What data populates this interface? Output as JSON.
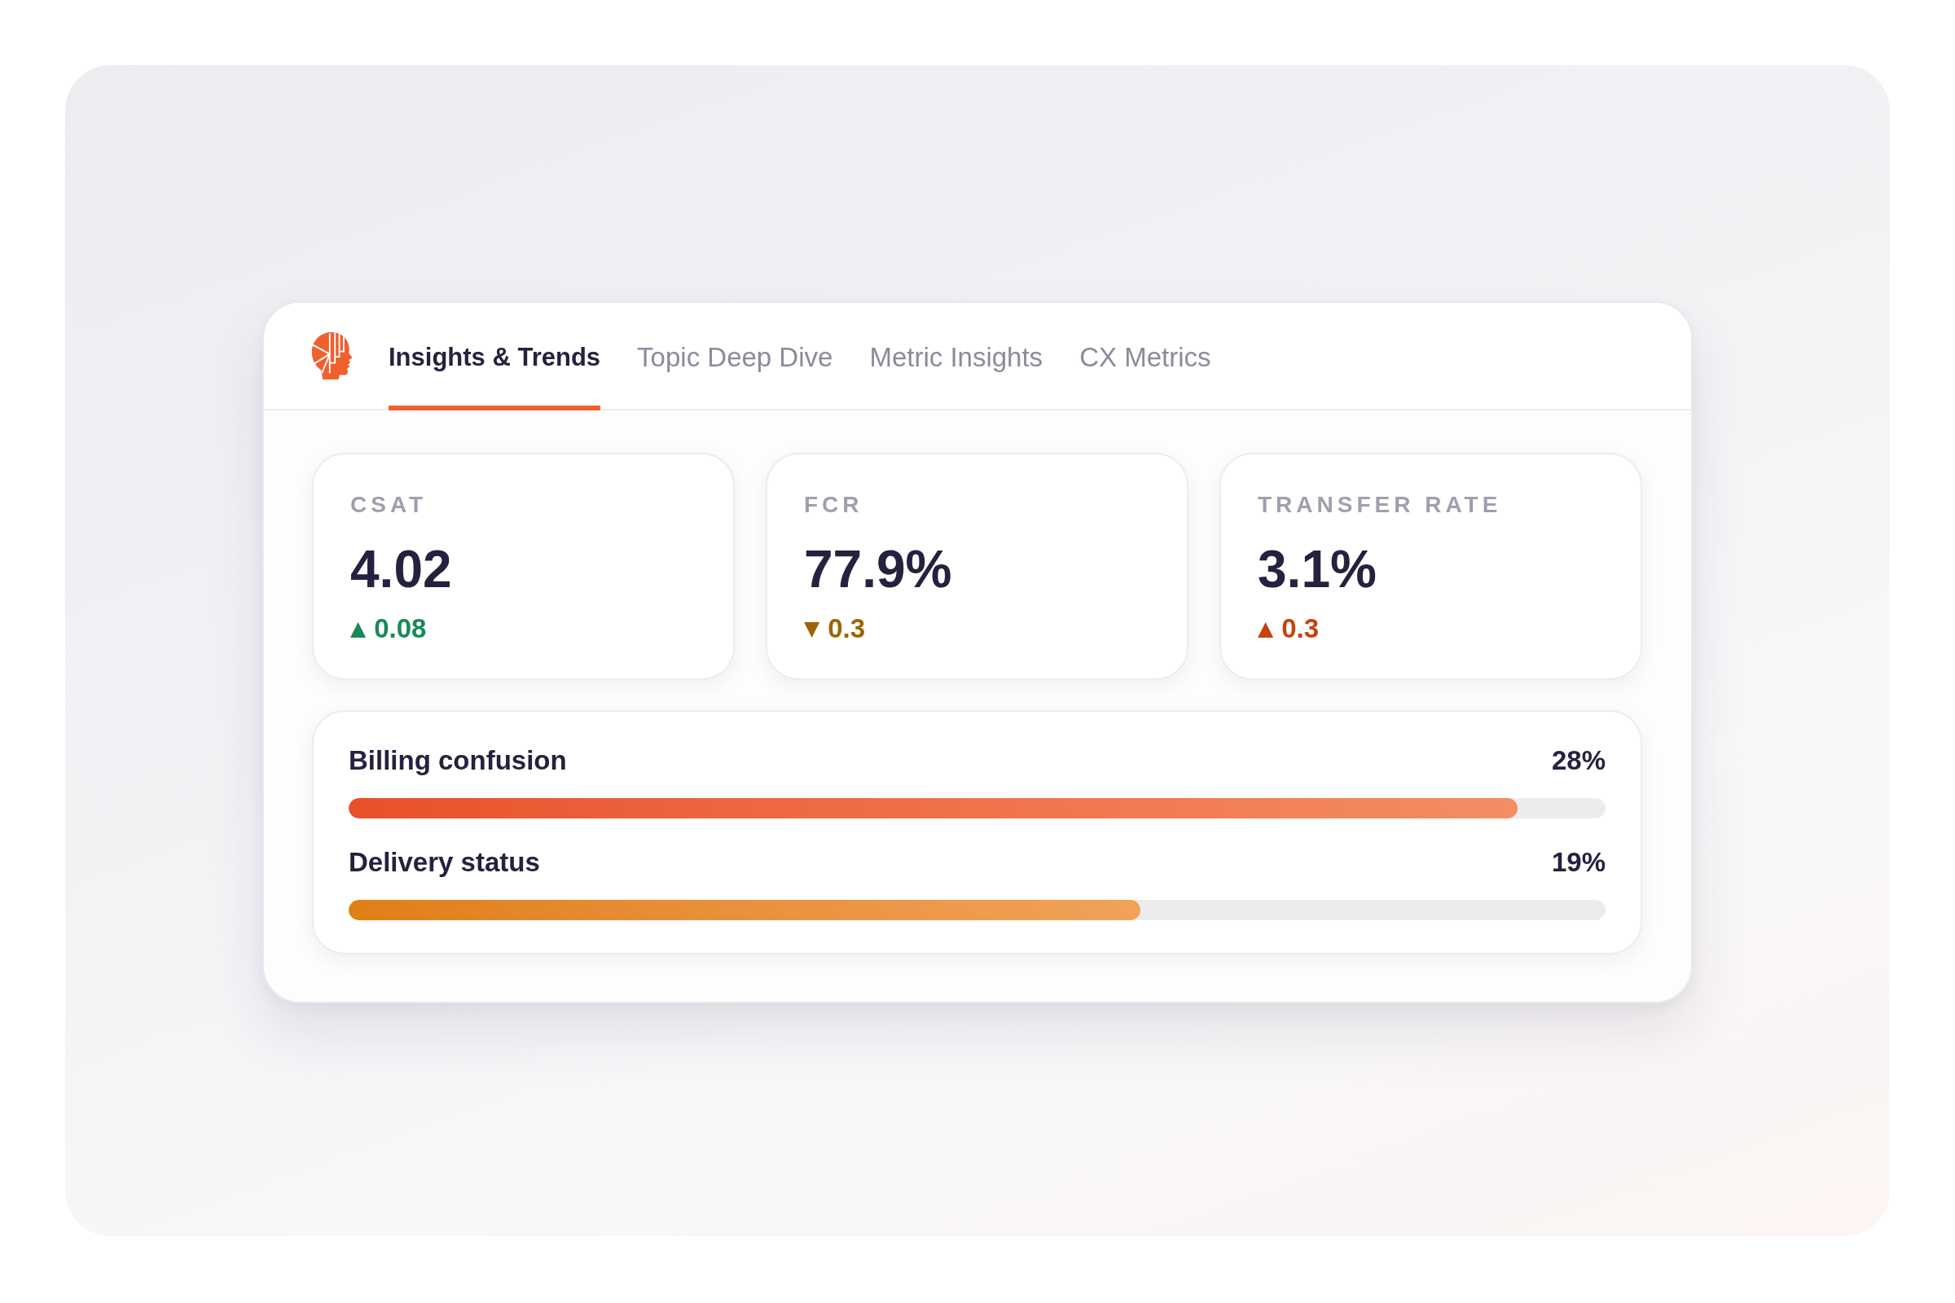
{
  "tabs": [
    {
      "label": "Insights & Trends",
      "selected": true
    },
    {
      "label": "Topic Deep Dive",
      "selected": false
    },
    {
      "label": "Metric Insights",
      "selected": false
    },
    {
      "label": "CX Metrics",
      "selected": false
    }
  ],
  "metrics": [
    {
      "label": "CSAT",
      "value": "4.02",
      "delta": {
        "arrow": "▲",
        "value": "0.08",
        "color": "#178a56"
      }
    },
    {
      "label": "FCR",
      "value": "77.9%",
      "delta": {
        "arrow": "▼",
        "value": "0.3",
        "color": "#9a6500"
      }
    },
    {
      "label": "TRANSFER RATE",
      "value": "3.1%",
      "delta": {
        "arrow": "▲",
        "value": "0.3",
        "color": "#c8420d"
      }
    }
  ],
  "topics": [
    {
      "name": "Billing confusion",
      "share": "28%",
      "level": 0.93,
      "color": "#e8502a"
    },
    {
      "name": "Delivery status",
      "share": "19%",
      "level": 0.63,
      "color": "#e07f14"
    }
  ]
}
